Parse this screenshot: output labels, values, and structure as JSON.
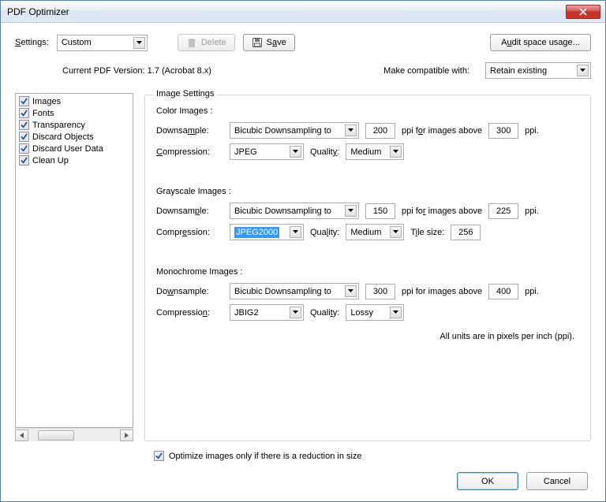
{
  "window": {
    "title": "PDF Optimizer"
  },
  "toolbar": {
    "settings_label": "Settings:",
    "settings_value": "Custom",
    "delete_label": "Delete",
    "save_label": "Save",
    "audit_label": "Audit space usage..."
  },
  "info": {
    "version_label": "Current PDF Version:",
    "version_value": "1.7 (Acrobat 8.x)",
    "compat_label": "Make compatible with:",
    "compat_value": "Retain existing"
  },
  "sidebar": {
    "items": [
      {
        "label": "Images",
        "checked": true
      },
      {
        "label": "Fonts",
        "checked": true
      },
      {
        "label": "Transparency",
        "checked": true
      },
      {
        "label": "Discard Objects",
        "checked": true
      },
      {
        "label": "Discard User Data",
        "checked": true
      },
      {
        "label": "Clean Up",
        "checked": true
      }
    ]
  },
  "panel": {
    "legend": "Image Settings",
    "color": {
      "title": "Color Images :",
      "downsample_label": "Downsample:",
      "downsample_value": "Bicubic Downsampling to",
      "ppi": "200",
      "above_label": "ppi for images above",
      "above_ppi": "300",
      "ppi_suffix": "ppi.",
      "compression_label": "Compression:",
      "compression_value": "JPEG",
      "quality_label": "Quality:",
      "quality_value": "Medium"
    },
    "gray": {
      "title": "Grayscale Images :",
      "downsample_label": "Downsample:",
      "downsample_value": "Bicubic Downsampling to",
      "ppi": "150",
      "above_label": "ppi for images above",
      "above_ppi": "225",
      "ppi_suffix": "ppi.",
      "compression_label": "Compression:",
      "compression_value": "JPEG2000",
      "quality_label": "Quality:",
      "quality_value": "Medium",
      "tile_label": "Tile size:",
      "tile_value": "256"
    },
    "mono": {
      "title": "Monochrome Images :",
      "downsample_label": "Downsample:",
      "downsample_value": "Bicubic Downsampling to",
      "ppi": "300",
      "above_label": "ppi for images above",
      "above_ppi": "400",
      "ppi_suffix": "ppi.",
      "compression_label": "Compression:",
      "compression_value": "JBIG2",
      "quality_label": "Quality:",
      "quality_value": "Lossy"
    },
    "units_note": "All units are in pixels per inch (ppi).",
    "optimize_label": "Optimize images only if there is a reduction in size",
    "optimize_checked": true
  },
  "footer": {
    "ok": "OK",
    "cancel": "Cancel"
  }
}
